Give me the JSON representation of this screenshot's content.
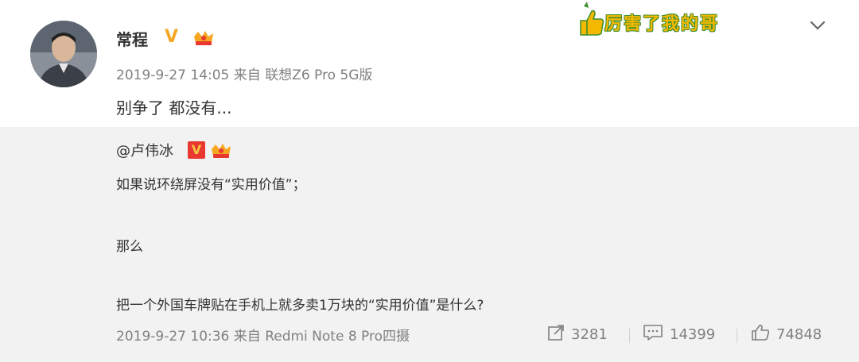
{
  "post": {
    "author": "常程",
    "timestamp": "2019-9-27 14:05",
    "source_prefix": "来自",
    "source": "联想Z6 Pro 5G版",
    "text": "别争了 都没有...",
    "v_badge": "V",
    "sticker_text": "厉害了我的哥"
  },
  "quoted": {
    "author": "@卢伟冰",
    "v_badge": "V",
    "line1": "如果说环绕屏没有“实用价值”；",
    "line2": "那么",
    "line3": "把一个外国车牌贴在手机上就多卖1万块的“实用价值”是什么?",
    "timestamp": "2019-9-27 10:36",
    "source_prefix": "来自",
    "source": "Redmi Note 8 Pro四摄",
    "reposts": "3281",
    "comments": "14399",
    "likes": "74848"
  },
  "colors": {
    "meta_gray": "#808080",
    "quote_bg": "#f2f2f2",
    "v_orange": "#f5a623",
    "v_red": "#e8382f"
  },
  "icons": [
    "avatar",
    "verified-v-icon",
    "crown-badge-icon",
    "thumbs-up-sticker",
    "chevron-down-icon",
    "repost-icon",
    "comment-icon",
    "like-icon"
  ]
}
